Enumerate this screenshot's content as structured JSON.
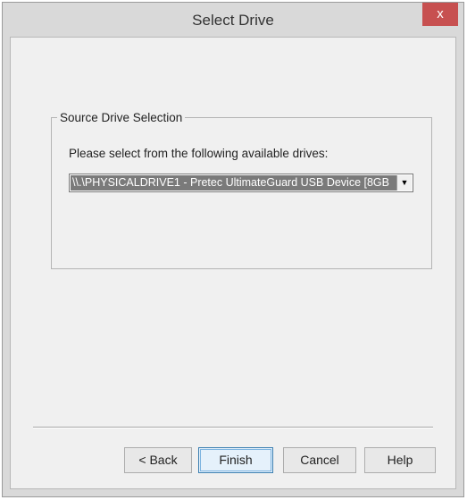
{
  "window": {
    "title": "Select Drive",
    "close_label": "x"
  },
  "group": {
    "legend": "Source Drive Selection",
    "prompt": "Please select from the following available drives:",
    "selected_drive": "\\\\.\\PHYSICALDRIVE1 - Pretec UltimateGuard USB Device [8GB"
  },
  "buttons": {
    "back": "< Back",
    "finish": "Finish",
    "cancel": "Cancel",
    "help": "Help"
  },
  "icons": {
    "close": "close-icon",
    "dropdown": "chevron-down-icon"
  },
  "colors": {
    "close_button": "#c75050",
    "selection_highlight": "#7a7a7a",
    "default_button_border": "#3c7fb1"
  }
}
